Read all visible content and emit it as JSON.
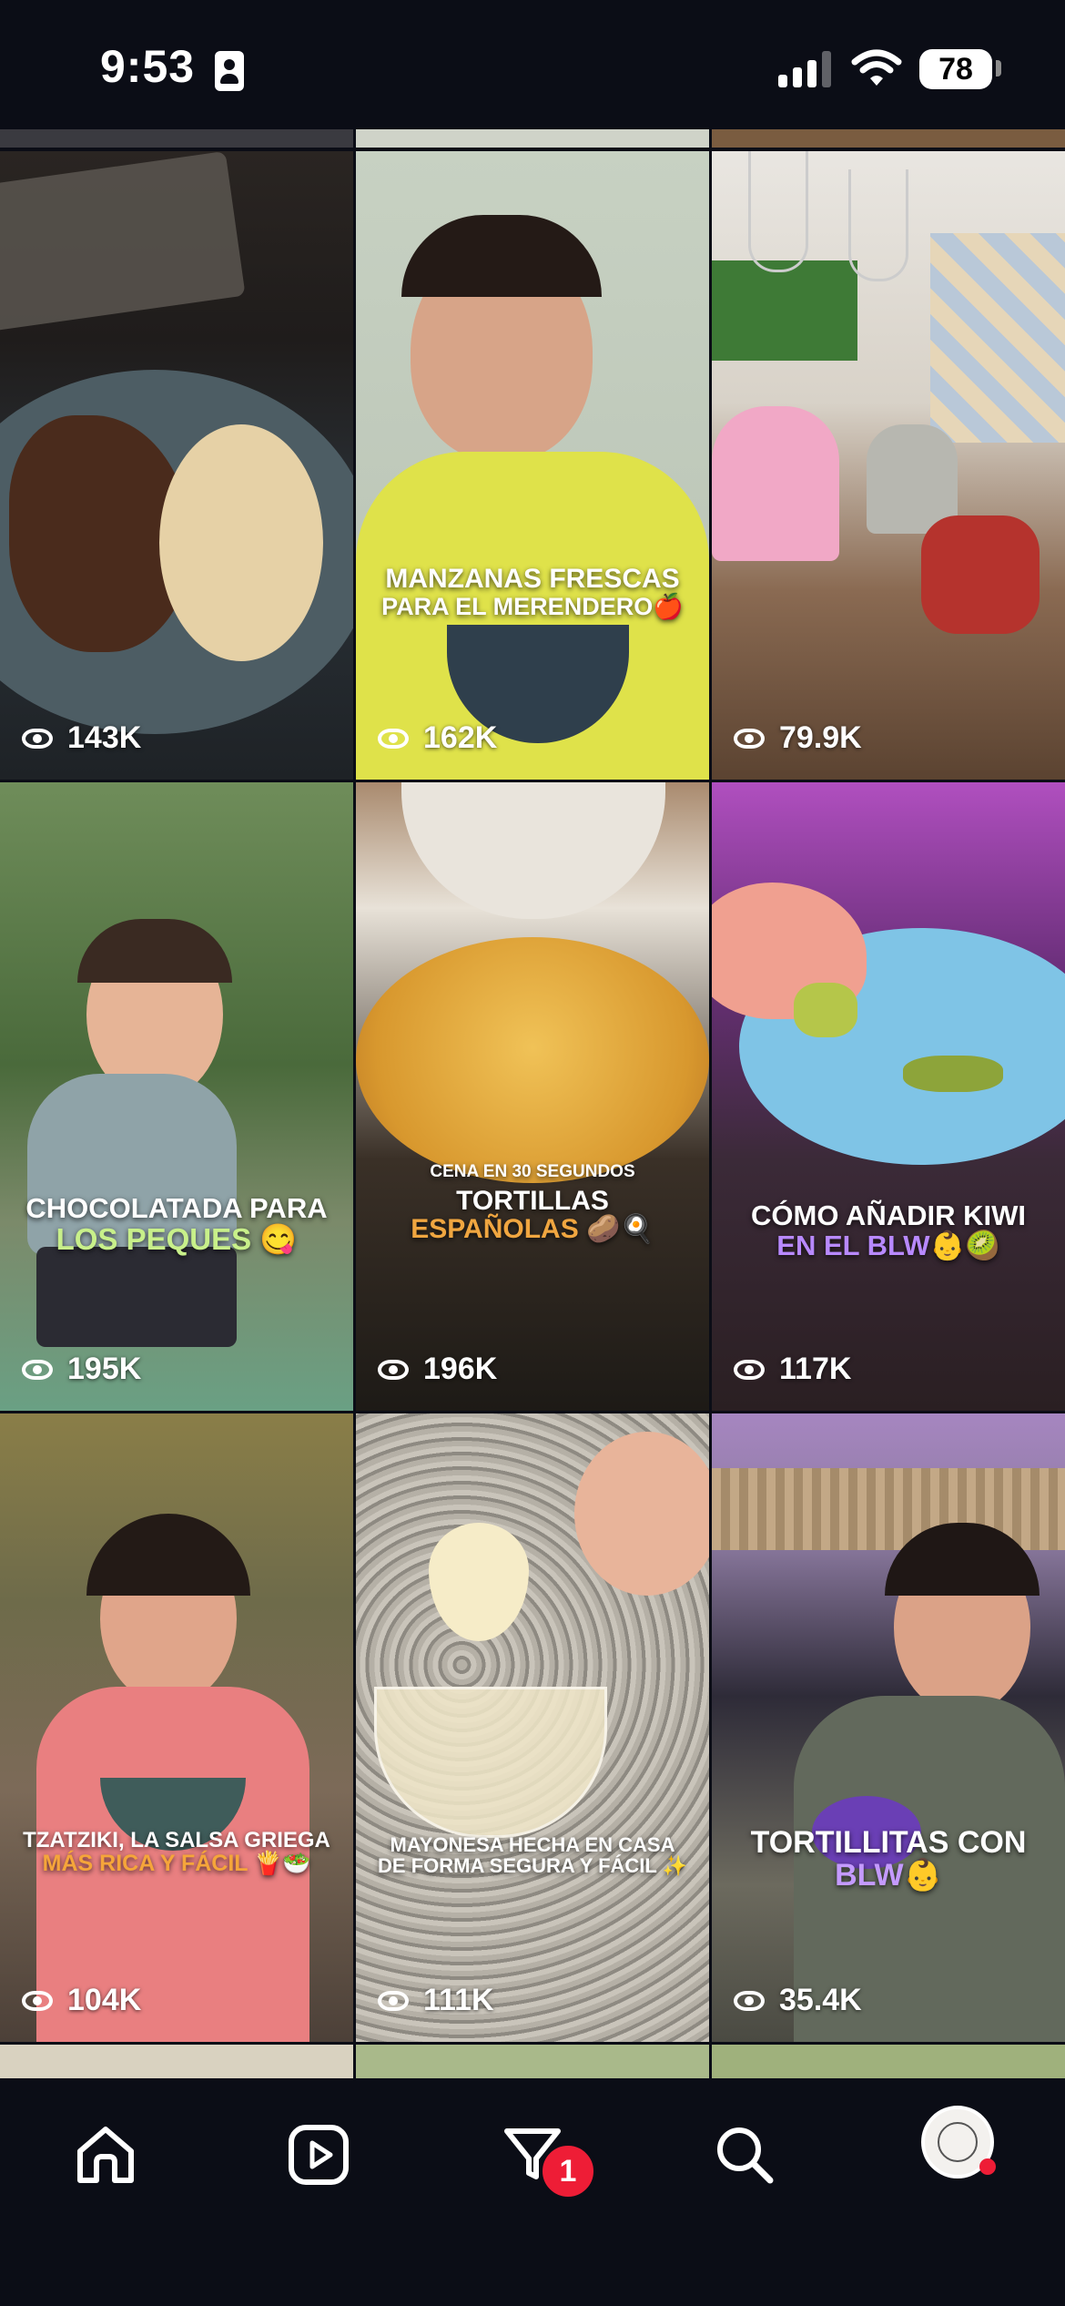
{
  "status_bar": {
    "time": "9:53",
    "battery": "78"
  },
  "reels": [
    {
      "views": "143K",
      "caption": [],
      "accent": "#ffffff"
    },
    {
      "views": "162K",
      "caption": [
        "MANZANAS FRESCAS",
        "PARA EL MERENDERO🍎"
      ],
      "accent": "#ffffff"
    },
    {
      "views": "79.9K",
      "caption": [],
      "accent": "#ffffff"
    },
    {
      "views": "195K",
      "caption": [
        "CHOCOLATADA PARA",
        "LOS PEQUES 😋"
      ],
      "accent": "#c8f08a"
    },
    {
      "views": "196K",
      "caption": [
        "CENA EN 30 SEGUNDOS",
        "TORTILLAS",
        "ESPAÑOLAS 🥔🍳"
      ],
      "accent": "#f0a640"
    },
    {
      "views": "117K",
      "caption": [
        "CÓMO AÑADIR KIWI",
        "EN EL BLW👶🥝"
      ],
      "accent": "#b889ff"
    },
    {
      "views": "104K",
      "caption": [
        "TZATZIKI, LA SALSA GRIEGA",
        "MÁS RICA Y FÁCIL 🍟🥗"
      ],
      "accent": "#f5a53a"
    },
    {
      "views": "111K",
      "caption": [
        "MAYONESA HECHA EN CASA",
        "DE FORMA SEGURA Y FÁCIL ✨"
      ],
      "accent": "#ffffff"
    },
    {
      "views": "35.4K",
      "caption": [
        "TORTILLITAS CON",
        "BLW👶"
      ],
      "accent": "#c49aff"
    }
  ],
  "nav": {
    "home": "home-icon",
    "reels": "reels-icon",
    "activity": "activity-filter-icon",
    "activity_badge": "1",
    "search": "search-icon",
    "profile": "profile-avatar"
  },
  "colors": {
    "background": "#0b0d16",
    "badge": "#ee1d36"
  }
}
